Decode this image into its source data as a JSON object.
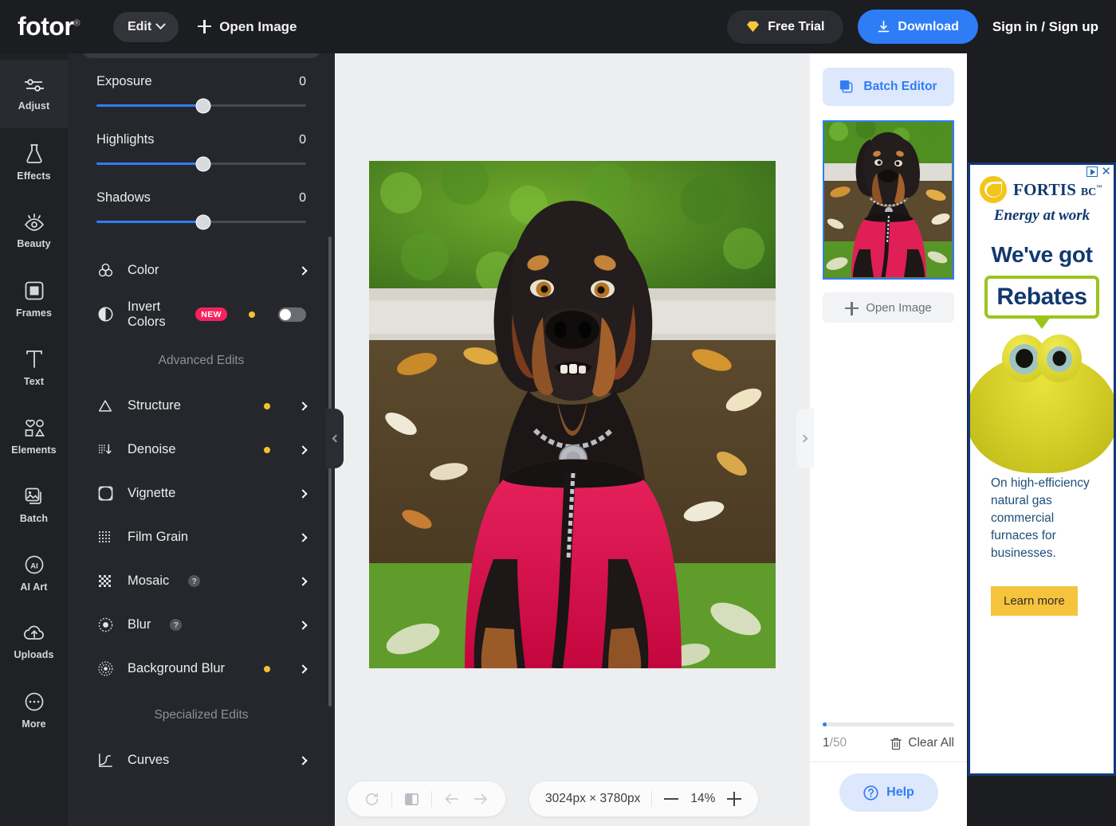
{
  "topbar": {
    "logo": "fotor",
    "logo_reg": "®",
    "edit_label": "Edit",
    "open_image_label": "Open Image",
    "free_trial_label": "Free Trial",
    "download_label": "Download",
    "signin_label": "Sign in / Sign up"
  },
  "rail": {
    "items": [
      {
        "label": "Adjust",
        "icon": "sliders-icon",
        "active": true
      },
      {
        "label": "Effects",
        "icon": "flask-icon",
        "active": false
      },
      {
        "label": "Beauty",
        "icon": "eye-icon",
        "active": false
      },
      {
        "label": "Frames",
        "icon": "frame-icon",
        "active": false
      },
      {
        "label": "Text",
        "icon": "text-t-icon",
        "active": false
      },
      {
        "label": "Elements",
        "icon": "shapes-icon",
        "active": false
      },
      {
        "label": "Batch",
        "icon": "images-icon",
        "active": false
      },
      {
        "label": "AI Art",
        "icon": "ai-circle-icon",
        "active": false
      },
      {
        "label": "Uploads",
        "icon": "cloud-up-icon",
        "active": false
      },
      {
        "label": "More",
        "icon": "ellipsis-icon",
        "active": false
      }
    ]
  },
  "adjust_panel": {
    "sliders": [
      {
        "label": "Exposure",
        "value": "0"
      },
      {
        "label": "Highlights",
        "value": "0"
      },
      {
        "label": "Shadows",
        "value": "0"
      }
    ],
    "color_row": {
      "label": "Color",
      "icon": "color-circles-icon"
    },
    "invert_row": {
      "label": "Invert Colors",
      "icon": "contrast-icon",
      "badge": "NEW",
      "toggle_on": false
    },
    "advanced_title": "Advanced Edits",
    "advanced_items": [
      {
        "label": "Structure",
        "icon": "triangle-icon",
        "pro": true,
        "help": false
      },
      {
        "label": "Denoise",
        "icon": "denoise-icon",
        "pro": true,
        "help": false
      },
      {
        "label": "Vignette",
        "icon": "vignette-icon",
        "pro": false,
        "help": false
      },
      {
        "label": "Film Grain",
        "icon": "grain-dots-icon",
        "pro": false,
        "help": false
      },
      {
        "label": "Mosaic",
        "icon": "mosaic-icon",
        "pro": false,
        "help": true
      },
      {
        "label": "Blur",
        "icon": "blur-icon",
        "pro": false,
        "help": true
      },
      {
        "label": "Background Blur",
        "icon": "bg-blur-icon",
        "pro": true,
        "help": false
      }
    ],
    "specialized_title": "Specialized Edits",
    "specialized_items": [
      {
        "label": "Curves",
        "icon": "curves-icon",
        "pro": false,
        "help": false
      }
    ]
  },
  "canvas": {
    "collapse_left_icon": "chevron-left-icon",
    "collapse_right_icon": "chevron-right-icon",
    "tools": {
      "rotate_icon": "rotate-icon",
      "compare_icon": "compare-icon",
      "undo_icon": "arrow-left-icon",
      "redo_icon": "arrow-right-icon"
    },
    "zoom": {
      "dimensions": "3024px × 3780px",
      "zoom_out_icon": "minus-icon",
      "level": "14%",
      "zoom_in_icon": "plus-icon"
    }
  },
  "batch": {
    "batch_editor_label": "Batch Editor",
    "batch_editor_icon": "stacked-squares-icon",
    "thumbnail_selected": true,
    "open_image_label": "Open Image",
    "count": "1",
    "count_sep": "/",
    "count_total": "50",
    "clear_all_label": "Clear All",
    "clear_all_icon": "trash-icon",
    "help_label": "Help",
    "help_icon": "question-circle-icon"
  },
  "ad": {
    "adchoices_icon": "adchoices-icon",
    "close_icon": "close-icon",
    "brand": "FORTIS",
    "brand_sub": "BC",
    "brand_tm": "™",
    "tagline": "Energy at work",
    "headline": "We've got",
    "bubble_text": "Rebates",
    "body": "On high-efficiency natural gas commercial furnaces for businesses.",
    "cta": "Learn more"
  },
  "colors": {
    "accent_blue": "#2f7df6",
    "pro_dot": "#f5c030",
    "new_badge": "#f5225f",
    "panel_bg": "#26272c",
    "rail_bg": "#202125",
    "topbar_bg": "#1c1d21",
    "canvas_bg": "#eceef0",
    "ad_navy": "#12386f",
    "ad_green": "#9cc41d",
    "ad_yellow": "#f6c33c"
  }
}
